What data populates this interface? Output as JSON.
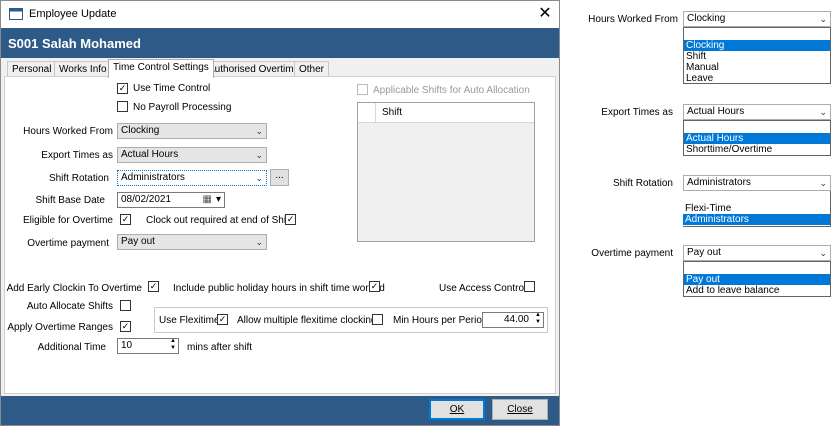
{
  "window": {
    "title": "Employee Update",
    "close_glyph": "✕",
    "employee_banner": "S001 Salah Mohamed"
  },
  "tabs": [
    {
      "label": "Personal"
    },
    {
      "label": "Works Info"
    },
    {
      "label": "Time Control Settings",
      "active": true
    },
    {
      "label": "Authorised Overtime"
    },
    {
      "label": "Other"
    }
  ],
  "form": {
    "use_time_control": {
      "label": "Use Time Control",
      "checked": true
    },
    "no_payroll_processing": {
      "label": "No Payroll Processing",
      "checked": false
    },
    "hours_worked_from": {
      "label": "Hours Worked From",
      "value": "Clocking"
    },
    "export_times_as": {
      "label": "Export Times as",
      "value": "Actual Hours"
    },
    "shift_rotation": {
      "label": "Shift Rotation",
      "value": "Administrators",
      "browse_label": "..."
    },
    "shift_base_date": {
      "label": "Shift Base Date",
      "value": "08/02/2021"
    },
    "eligible_for_overtime": {
      "label": "Eligible for Overtime",
      "checked": true
    },
    "clock_out_required": {
      "label": "Clock out required at end of Shift",
      "checked": true
    },
    "overtime_payment": {
      "label": "Overtime payment",
      "value": "Pay out"
    },
    "applicable_shifts": {
      "label": "Applicable Shifts for Auto Allocation",
      "checked": false,
      "column_header": "Shift"
    },
    "add_early_clockin": {
      "label": "Add Early Clockin To Overtime",
      "checked": true
    },
    "include_public_holiday": {
      "label": "Include public holiday hours in shift time worked",
      "checked": true
    },
    "use_access_control": {
      "label": "Use Access Control",
      "checked": false
    },
    "auto_allocate_shifts": {
      "label": "Auto Allocate Shifts",
      "checked": false
    },
    "apply_overtime_ranges": {
      "label": "Apply Overtime Ranges",
      "checked": true
    },
    "use_flexitime": {
      "label": "Use Flexitime",
      "checked": true
    },
    "allow_multiple_flexitime": {
      "label": "Allow multiple flexitime clockings",
      "checked": false
    },
    "min_hours_per_period": {
      "label": "Min Hours per Period",
      "value": "44.00"
    },
    "additional_time": {
      "label": "Additional Time",
      "value": "10",
      "suffix": "mins after shift"
    }
  },
  "buttons": {
    "ok": "OK",
    "close": "Close"
  },
  "dropdowns": [
    {
      "label": "Hours Worked From",
      "value": "Clocking",
      "options": [
        "Clocking",
        "Shift",
        "Manual",
        "Leave"
      ],
      "selected": "Clocking"
    },
    {
      "label": "Export Times as",
      "value": "Actual Hours",
      "options": [
        "Actual Hours",
        "Shorttime/Overtime"
      ],
      "selected": "Actual Hours"
    },
    {
      "label": "Shift Rotation",
      "value": "Administrators",
      "options": [
        "Flexi-Time",
        "Administrators"
      ],
      "selected": "Administrators"
    },
    {
      "label": "Overtime payment",
      "value": "Pay out",
      "options": [
        "Pay out",
        "Add to leave balance"
      ],
      "selected": "Pay out"
    }
  ],
  "glyphs": {
    "check": "✓",
    "arrow": "⌄",
    "spin_up": "▲",
    "spin_down": "▼",
    "calendar": "▦",
    "cal_arrow": "▾"
  },
  "colors": {
    "banner": "#2e5a88",
    "selection": "#0078d7"
  }
}
